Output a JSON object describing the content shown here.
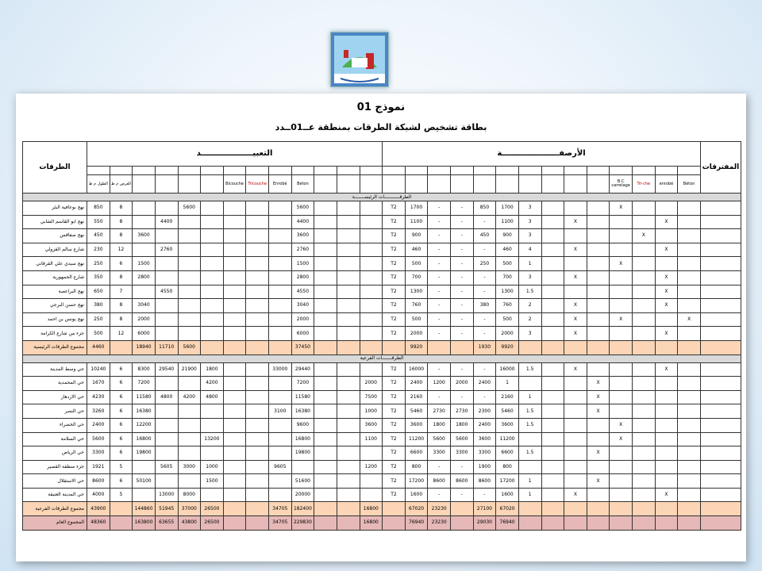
{
  "title": "نموذج 01",
  "subtitle": "بطاقة تشخيص لشبكة الطرقات بمنطقة عــ01ــدد",
  "headers": {
    "roads": "الطرقات",
    "notes": "المفترقات",
    "coating": "التعبيـــــــــــــــــــد",
    "sidewalks": "الأرصفـــــــــــــــــــــة",
    "length": "الطول",
    "width": "العرض",
    "coat_sub": [
      "",
      "",
      "",
      "",
      "",
      "",
      "",
      ""
    ],
    "coat_cols": [
      "الطول م ط",
      "العرض م ط",
      "",
      "",
      "",
      "",
      "",
      "Béton",
      "Enrobé",
      "Tricouche",
      "Bicouche",
      "",
      ""
    ],
    "side_cols": [
      "",
      "",
      "",
      "",
      "",
      "",
      "",
      "",
      "Béton",
      "enrobé",
      "Tri-che",
      "B.C carrelage",
      ""
    ]
  },
  "section1_label": "الطرقـــــــــــات الرئيســـــــة",
  "section2_label": "الطرقـــــــات الفرعية",
  "rows1": [
    [
      "نهج بوعافية البئر",
      [
        "850",
        "8",
        "",
        "",
        "5600",
        "",
        "",
        "",
        "",
        "",
        "5600",
        "",
        "1700",
        "850",
        "-",
        "-",
        "T2",
        "1700",
        "3",
        "",
        "X",
        "",
        "",
        "",
        "",
        "X"
      ]
    ]
  ],
  "table_rows": [
    {
      "name": "نهج بوعافية البئر",
      "c": [
        "850",
        "8",
        "",
        "",
        "5600",
        "",
        "",
        "",
        "",
        "5600",
        "",
        "",
        "",
        "T2",
        "1700",
        "-",
        "-",
        "850",
        "1700",
        "3",
        "",
        "",
        "",
        "X",
        "",
        "",
        "",
        "X",
        ""
      ]
    },
    {
      "name": "نهج ابو القاسم الشابي",
      "c": [
        "550",
        "8",
        "",
        "4400",
        "",
        "",
        "",
        "",
        "",
        "4400",
        "",
        "",
        "",
        "T2",
        "1100",
        "-",
        "-",
        "-",
        "1100",
        "3",
        "",
        "X",
        "",
        "",
        "",
        "X",
        "",
        ""
      ]
    },
    {
      "name": "نهج صفاقس",
      "c": [
        "450",
        "8",
        "3600",
        "",
        "",
        "",
        "",
        "",
        "",
        "3600",
        "",
        "",
        "",
        "T2",
        "900",
        "-",
        "-",
        "450",
        "900",
        "3",
        "",
        "",
        "",
        "",
        "X",
        "",
        "",
        ""
      ]
    },
    {
      "name": "شارع سالم القزولي",
      "c": [
        "230",
        "12",
        "",
        "2760",
        "",
        "",
        "",
        "",
        "",
        "2760",
        "",
        "",
        "",
        "T2",
        "460",
        "-",
        "-",
        "-",
        "460",
        "4",
        "",
        "X",
        "",
        "",
        "",
        "X",
        "",
        ""
      ]
    },
    {
      "name": "نهج سيدي علي القرقاني",
      "c": [
        "250",
        "6",
        "1500",
        "",
        "",
        "",
        "",
        "",
        "",
        "1500",
        "",
        "",
        "",
        "T2",
        "500",
        "-",
        "-",
        "250",
        "500",
        "1",
        "",
        "",
        "",
        "X",
        "",
        "",
        "",
        ""
      ]
    },
    {
      "name": "شارع الجمهورية",
      "c": [
        "350",
        "8",
        "2800",
        "",
        "",
        "",
        "",
        "",
        "",
        "2800",
        "",
        "",
        "",
        "T2",
        "700",
        "-",
        "-",
        "-",
        "700",
        "3",
        "",
        "X",
        "",
        "",
        "",
        "X",
        "",
        ""
      ]
    },
    {
      "name": "نهج البراعصة",
      "c": [
        "650",
        "7",
        "",
        "4550",
        "",
        "",
        "",
        "",
        "",
        "4550",
        "",
        "",
        "",
        "T2",
        "1300",
        "-",
        "-",
        "-",
        "1300",
        "1.5",
        "",
        "",
        "",
        "",
        "",
        "X",
        "",
        "X"
      ]
    },
    {
      "name": "نهج حسن البرجي",
      "c": [
        "380",
        "8",
        "3040",
        "",
        "",
        "",
        "",
        "",
        "",
        "3040",
        "",
        "",
        "",
        "T2",
        "760",
        "-",
        "-",
        "380",
        "760",
        "2",
        "",
        "X",
        "",
        "",
        "",
        "X",
        "",
        ""
      ]
    },
    {
      "name": "نهج يونس بن احمد",
      "c": [
        "250",
        "8",
        "2000",
        "",
        "",
        "",
        "",
        "",
        "",
        "2000",
        "",
        "",
        "",
        "T2",
        "500",
        "-",
        "-",
        "-",
        "500",
        "2",
        "",
        "X",
        "",
        "X",
        "",
        "",
        "X",
        ""
      ]
    },
    {
      "name": "جزء من شارع الكرامة",
      "c": [
        "500",
        "12",
        "6000",
        "",
        "",
        "",
        "",
        "",
        "",
        "6000",
        "",
        "",
        "",
        "T2",
        "2000",
        "-",
        "-",
        "-",
        "2000",
        "3",
        "",
        "X",
        "",
        "",
        "",
        "X",
        "",
        ""
      ]
    }
  ],
  "total1": {
    "name": "مجموع الطرقات الرئيسية",
    "c": [
      "4460",
      "",
      "18940",
      "11710",
      "5600",
      "",
      "",
      "",
      "",
      "37450",
      "",
      "",
      "",
      "",
      "9920",
      "",
      "",
      "1930",
      "9920",
      "",
      "",
      "",
      "",
      "",
      "",
      "",
      "",
      ""
    ]
  },
  "table_rows2": [
    {
      "name": "حي وسط المدينة",
      "c": [
        "10240",
        "6",
        "8300",
        "29540",
        "21900",
        "1800",
        "",
        "",
        "33000",
        "29440",
        "",
        "",
        "",
        "T2",
        "16000",
        "-",
        "-",
        "-",
        "16000",
        "1.5",
        "",
        "X",
        "",
        "",
        "",
        "X",
        "",
        ""
      ]
    },
    {
      "name": "حي المحمدية",
      "c": [
        "1670",
        "6",
        "7200",
        "",
        "",
        "4200",
        "",
        "",
        "",
        "7200",
        "",
        "",
        "2000",
        "T2",
        "2400",
        "1200",
        "2000",
        "2400",
        "1",
        "",
        "",
        "",
        "X",
        "",
        "",
        "",
        "",
        ""
      ]
    },
    {
      "name": "حي الازدهار",
      "c": [
        "4230",
        "6",
        "11580",
        "4800",
        "4200",
        "4800",
        "",
        "",
        "",
        "11580",
        "",
        "",
        "7500",
        "T2",
        "2160",
        "-",
        "-",
        "-",
        "2160",
        "1",
        "",
        "",
        "X",
        "",
        "",
        "",
        "",
        ""
      ]
    },
    {
      "name": "حي النصر",
      "c": [
        "3260",
        "6",
        "16380",
        "",
        "",
        "",
        "",
        "",
        "3100",
        "16380",
        "",
        "",
        "1000",
        "T2",
        "5460",
        "2730",
        "2730",
        "2300",
        "5460",
        "1.5",
        "",
        "",
        "X",
        "",
        "",
        "",
        "",
        ""
      ]
    },
    {
      "name": "حي الخضراء",
      "c": [
        "2400",
        "6",
        "12200",
        "",
        "",
        "",
        "",
        "",
        "",
        "9600",
        "",
        "",
        "3600",
        "T2",
        "3600",
        "1800",
        "1800",
        "2400",
        "3600",
        "1.5",
        "",
        "",
        "",
        "X",
        "",
        "",
        "",
        ""
      ]
    },
    {
      "name": "حي السلامة",
      "c": [
        "5600",
        "6",
        "16800",
        "",
        "",
        "13200",
        "",
        "",
        "",
        "16800",
        "",
        "",
        "1100",
        "T2",
        "11200",
        "5600",
        "5600",
        "3600",
        "11200",
        "",
        "",
        "",
        "",
        "X",
        "",
        "",
        "",
        ""
      ]
    },
    {
      "name": "حي الرياض",
      "c": [
        "3300",
        "6",
        "19800",
        "",
        "",
        "",
        "",
        "",
        "",
        "19800",
        "",
        "",
        "",
        "T2",
        "6600",
        "3300",
        "3300",
        "3300",
        "6600",
        "1.5",
        "",
        "",
        "X",
        "",
        "",
        "",
        "",
        ""
      ]
    },
    {
      "name": "جزء منطقة القصير",
      "c": [
        "1921",
        "5",
        "",
        "5605",
        "3000",
        "1000",
        "",
        "",
        "9605",
        "",
        "",
        "",
        "1200",
        "T2",
        "800",
        "-",
        "-",
        "1900",
        "800",
        "",
        "",
        "",
        "",
        "",
        "",
        "",
        "",
        ""
      ]
    },
    {
      "name": "حي الاستقلال",
      "c": [
        "8600",
        "6",
        "50100",
        "",
        "",
        "1500",
        "",
        "",
        "",
        "51600",
        "",
        "",
        "",
        "T2",
        "17200",
        "8600",
        "8600",
        "8600",
        "17200",
        "1",
        "",
        "",
        "X",
        "",
        "",
        "",
        "",
        ""
      ]
    },
    {
      "name": "حي المدينة العتيقة",
      "c": [
        "4000",
        "5",
        "",
        "13000",
        "8000",
        "",
        "",
        "",
        "",
        "20000",
        "",
        "",
        "",
        "T2",
        "1600",
        "-",
        "-",
        "-",
        "1600",
        "1",
        "",
        "X",
        "",
        "",
        "",
        "X",
        "",
        ""
      ]
    }
  ],
  "total2": {
    "name": "مجموع الطرقات الفرعية",
    "c": [
      "43900",
      "",
      "144860",
      "51945",
      "37000",
      "26500",
      "",
      "",
      "34705",
      "182400",
      "",
      "",
      "16800",
      "",
      "67020",
      "23230",
      "",
      "27100",
      "67020",
      "",
      "",
      "",
      "",
      "",
      "",
      "",
      "",
      ""
    ]
  },
  "grand": {
    "name": "المجموع العام",
    "c": [
      "48360",
      "",
      "163800",
      "63655",
      "43800",
      "26500",
      "",
      "",
      "34705",
      "229830",
      "",
      "",
      "16800",
      "",
      "76940",
      "23230",
      "",
      "29030",
      "76940",
      "",
      "",
      "",
      "",
      "",
      "",
      "",
      "",
      ""
    ]
  }
}
